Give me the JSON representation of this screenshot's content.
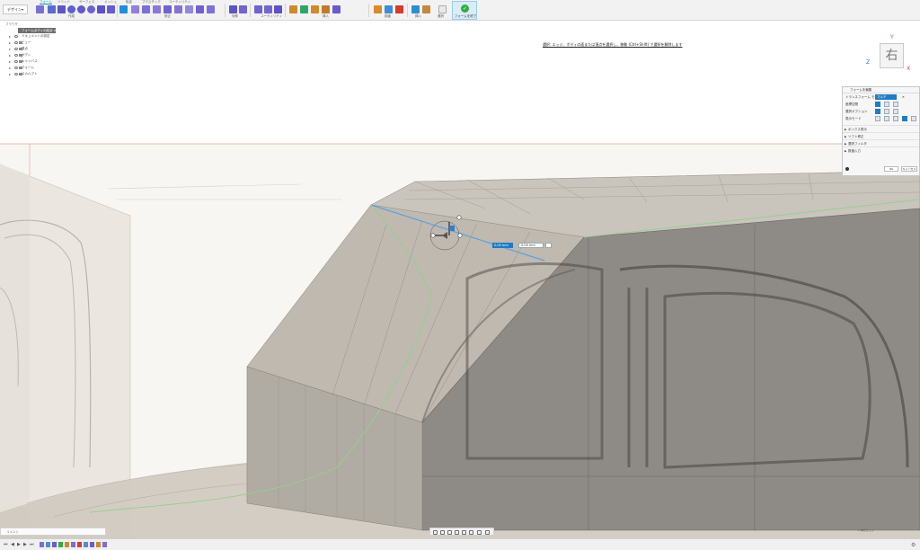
{
  "toolbar": {
    "workspace_label": "デザイン",
    "tabs": [
      "フォーム",
      "ソリッド",
      "サーフェス",
      "メッシュ",
      "板金",
      "プラスチック",
      "ユーティリティ"
    ],
    "active_tab": "フォーム",
    "groups": [
      "作成",
      "修正",
      "対称",
      "ユーティリティ",
      "挿入",
      "検査",
      "選択",
      "フォームを終了"
    ],
    "accent_color": "#0696d7",
    "finish_color": "#2fae3d"
  },
  "browser": {
    "header": "ブラウザ",
    "root": "フォームボディの結合 v1",
    "items": [
      "ドキュメントの設定",
      "ビュー",
      "原点",
      "ボディ",
      "キャンバス",
      "フォーム",
      "スカルプト"
    ]
  },
  "prompt": "選択: エッジ、ボディの面または頂点を選択し、移動 (Ctrl+Shift) で選択を解除します",
  "viewcube": {
    "face": "右",
    "x": "X",
    "z": "Z",
    "y": "Y"
  },
  "panel": {
    "title": "フォームを編集",
    "mode_label": "トランスフォーム モード",
    "mode_value": "マルチ",
    "row2": "座標空間",
    "row3": "選択オプション",
    "row4": "表示モード",
    "sec1": "ボックス表示",
    "sec2": "ソフト修正",
    "sec3": "選択フィルタ",
    "sec4": "数値入力",
    "ok": "OK",
    "cancel": "キャンセル"
  },
  "dimensions": {
    "value1": "0.00 mm",
    "value2": "0.00 mm"
  },
  "status": {
    "left": "コメント",
    "right": "1 本のエッジ"
  }
}
